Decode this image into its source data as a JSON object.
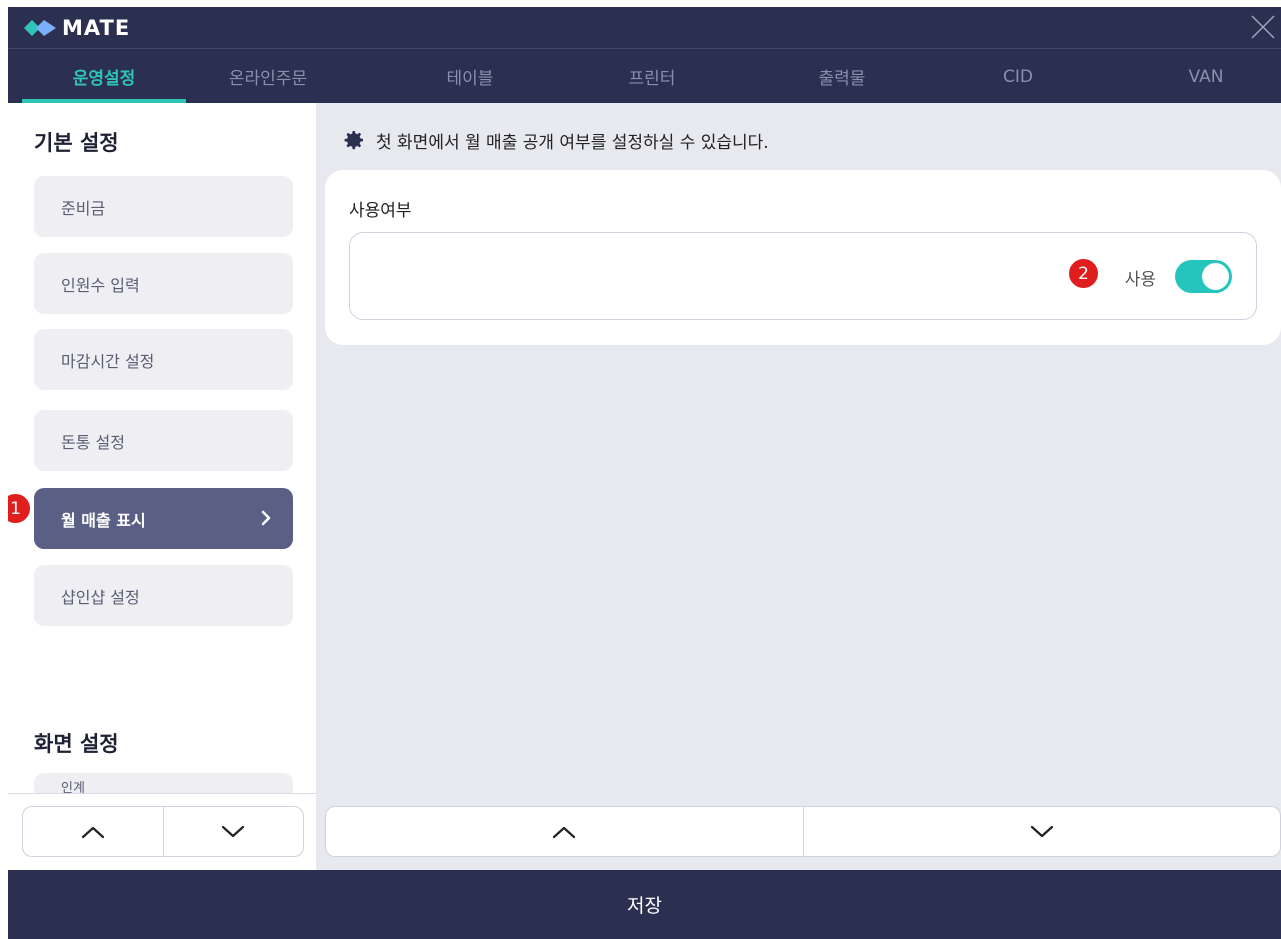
{
  "header": {
    "app_name": "MATE",
    "tabs": [
      {
        "label": "운영설정",
        "active": true
      },
      {
        "label": "온라인주문",
        "active": false
      },
      {
        "label": "테이블",
        "active": false
      },
      {
        "label": "프린터",
        "active": false
      },
      {
        "label": "출력물",
        "active": false
      },
      {
        "label": "CID",
        "active": false
      },
      {
        "label": "VAN",
        "active": false
      }
    ]
  },
  "sidebar": {
    "section_basic": "기본 설정",
    "items": [
      {
        "label": "준비금",
        "active": false
      },
      {
        "label": "인원수 입력",
        "active": false
      },
      {
        "label": "마감시간 설정",
        "active": false
      },
      {
        "label": "돈통 설정",
        "active": false
      },
      {
        "label": "월 매출 표시",
        "active": true
      },
      {
        "label": "샵인샵 설정",
        "active": false
      }
    ],
    "section_screen": "화면 설정",
    "partial_item": "인계"
  },
  "annotations": {
    "badge1": "1",
    "badge2": "2"
  },
  "main": {
    "notice": "첫 화면에서 월 매출 공개 여부를 설정하실 수 있습니다.",
    "card_label": "사용여부",
    "toggle_label": "사용",
    "toggle_on": true
  },
  "footer": {
    "save_label": "저장"
  },
  "colors": {
    "header_bg": "#2c3050",
    "accent": "#2ec4b6",
    "active_item": "#5a5f86",
    "badge": "#e01e1e"
  }
}
